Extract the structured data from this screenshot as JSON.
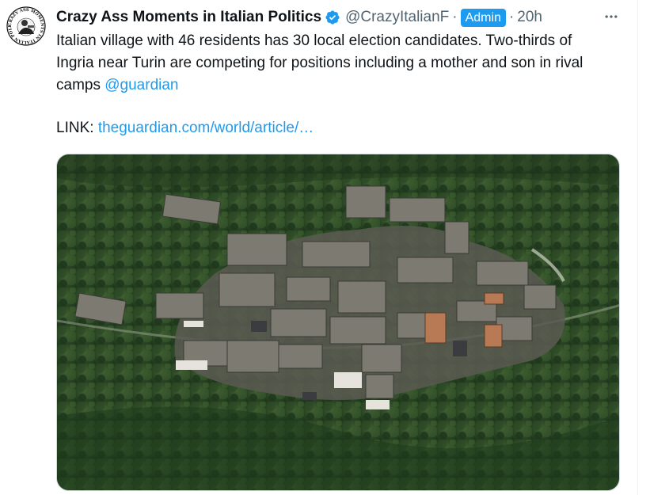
{
  "tweet": {
    "display_name": "Crazy Ass Moments in Italian Politics",
    "handle": "@CrazyItalianF",
    "separator": "·",
    "badge": "Admin",
    "time": "20h",
    "text_main": "Italian village with 46 residents has 30 local election candidates. Two-thirds of Ingria near Turin are competing for positions including a mother and son in rival camps ",
    "mention": "@guardian",
    "link_prefix": "LINK: ",
    "link_text": "theguardian.com/world/article/…",
    "avatar_text": "CRAZY ASS MOMENTS IN ITALIAN POLITICS"
  },
  "icons": {
    "verified": "verified-badge-icon",
    "more": "more-options-icon"
  },
  "colors": {
    "accent": "#1d9bf0",
    "text": "#0f1419",
    "muted": "#536471",
    "border": "#cfd9de"
  }
}
